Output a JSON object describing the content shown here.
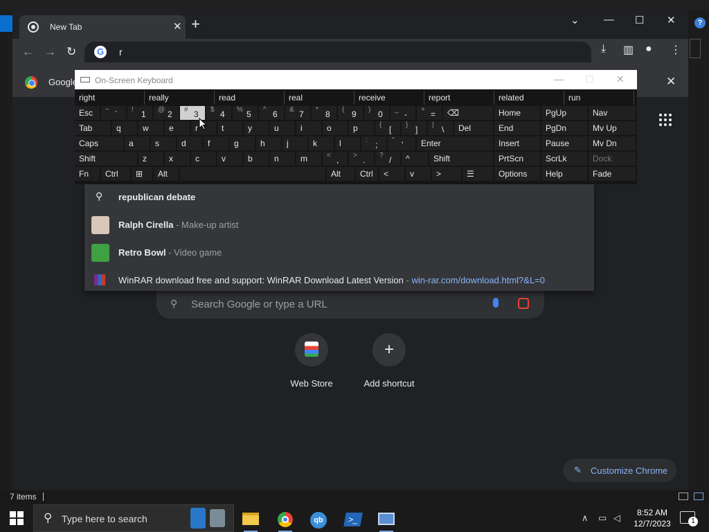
{
  "explorer": {
    "status_count": "7 items",
    "help_glyph": "?"
  },
  "chrome": {
    "tab_title": "New Tab",
    "tab_close": "✕",
    "new_tab": "+",
    "window_controls": {
      "dropdown": "⌄",
      "minimize": "—",
      "maximize": "☐",
      "close": "✕"
    },
    "omnibox_text": "r",
    "omnibox_google_glyph": "G",
    "bookmark_label": "Google",
    "bookmark_bar_close": "✕",
    "suggestions": [
      {
        "type": "search",
        "icon": "search-icon",
        "text": "republican debate",
        "sub": "",
        "url": ""
      },
      {
        "type": "entity",
        "icon": "person-thumbnail",
        "text": "Ralph Cirella",
        "sub": " - Make-up artist",
        "url": ""
      },
      {
        "type": "entity",
        "icon": "game-thumbnail",
        "text": "Retro Bowl",
        "sub": " - Video game",
        "url": ""
      },
      {
        "type": "history",
        "icon": "winrar-icon",
        "text": "WinRAR download free and support: WinRAR Download Latest Version",
        "sub": " - ",
        "url": "win-rar.com/download.html?&L=0"
      }
    ],
    "search_placeholder": "Search Google or type a URL",
    "shortcuts": [
      {
        "label": "Web Store",
        "icon": "web-store-icon"
      },
      {
        "label": "Add shortcut",
        "icon": "add-icon"
      }
    ],
    "customize_label": "Customize Chrome"
  },
  "osk": {
    "title": "On-Screen Keyboard",
    "title_controls": {
      "minimize": "—",
      "maximize": "☐",
      "close": "✕"
    },
    "predictions": [
      "right",
      "really",
      "read",
      "real",
      "receive",
      "report",
      "related",
      "run"
    ],
    "nav_keys": [
      [
        "Home",
        "PgUp",
        "Nav"
      ],
      [
        "End",
        "PgDn",
        "Mv Up"
      ],
      [
        "Insert",
        "Pause",
        "Mv Dn"
      ],
      [
        "PrtScn",
        "ScrLk",
        "Dock"
      ],
      [
        "Options",
        "Help",
        "Fade"
      ]
    ],
    "row1": [
      {
        "top": "",
        "main": "Esc"
      },
      {
        "top": "~",
        "main": "`"
      },
      {
        "top": "!",
        "main": "1"
      },
      {
        "top": "@",
        "main": "2"
      },
      {
        "top": "#",
        "main": "3"
      },
      {
        "top": "$",
        "main": "4"
      },
      {
        "top": "%",
        "main": "5"
      },
      {
        "top": "^",
        "main": "6"
      },
      {
        "top": "&",
        "main": "7"
      },
      {
        "top": "*",
        "main": "8"
      },
      {
        "top": "(",
        "main": "9"
      },
      {
        "top": ")",
        "main": "0"
      },
      {
        "top": "_",
        "main": "-"
      },
      {
        "top": "+",
        "main": "="
      },
      {
        "top": "",
        "main": "⌫"
      }
    ],
    "row2": [
      "Tab",
      "q",
      "w",
      "e",
      "r",
      "t",
      "y",
      "u",
      "i",
      "o",
      "p",
      "[",
      "]",
      "\\",
      "Del"
    ],
    "row2_tops": [
      "",
      "",
      "",
      "",
      "",
      "",
      "",
      "",
      "",
      "",
      "",
      "{",
      "}",
      "|",
      ""
    ],
    "row3": [
      "Caps",
      "a",
      "s",
      "d",
      "f",
      "g",
      "h",
      "j",
      "k",
      "l",
      ";",
      "'",
      "Enter"
    ],
    "row3_tops": [
      "",
      "",
      "",
      "",
      "",
      "",
      "",
      "",
      "",
      "",
      ":",
      "\"",
      ""
    ],
    "row4": [
      "Shift",
      "z",
      "x",
      "c",
      "v",
      "b",
      "n",
      "m",
      ",",
      ".",
      "/",
      "^",
      "Shift"
    ],
    "row4_tops": [
      "",
      "",
      "",
      "",
      "",
      "",
      "",
      "",
      "<",
      ">",
      "?",
      "",
      ""
    ],
    "row5": [
      "Fn",
      "Ctrl",
      "⊞",
      "Alt",
      "",
      "Alt",
      "Ctrl",
      "<",
      "v",
      ">",
      "☰"
    ]
  },
  "taskbar": {
    "search_placeholder": "Type here to search",
    "apps": [
      "file-explorer-icon",
      "chrome-icon",
      "qbittorrent-icon",
      "powershell-icon",
      "remote-desktop-icon"
    ],
    "time": "8:52 AM",
    "date": "12/7/2023",
    "notifications_count": "1"
  }
}
